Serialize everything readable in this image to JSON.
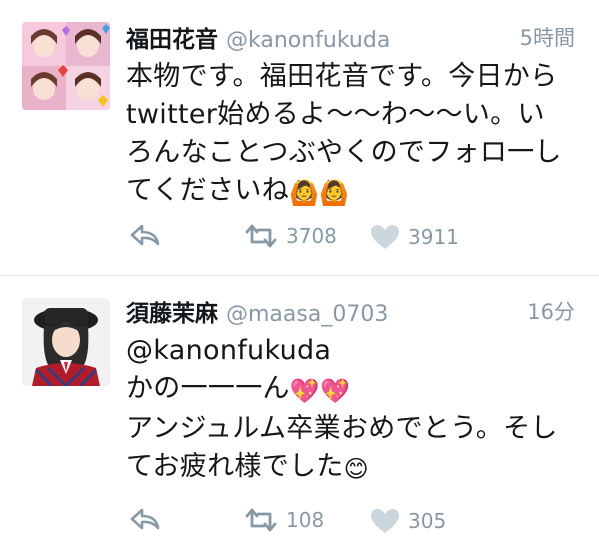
{
  "tweets": [
    {
      "name": "福田花音",
      "handle": "@kanonfukuda",
      "time": "5時間",
      "text": "本物です。福田花音です。今日から\ntwitter始めるよ〜〜わ〜〜い。い\nろんなことつぶやくのでフォロ一し\nてくださいね",
      "emojis": "🙆🙆",
      "retweets": "3708",
      "likes": "3911"
    },
    {
      "name": "須藤茉麻",
      "handle": "@maasa_0703",
      "time": "16分",
      "text_line1": "@kanonfukuda",
      "text_line2": "かの一一一ん",
      "emojis_line2": "💖💖",
      "text_rest": "アンジュルム卒業おめでとう。そし\nてお疲れ様でした",
      "emojis_rest": "😊",
      "retweets": "108",
      "likes": "305"
    }
  ],
  "colors": {
    "text": "#14171a",
    "muted": "#8899a6",
    "divider": "#e1e8ed"
  },
  "icons": {
    "reply": "reply-icon",
    "retweet": "retweet-icon",
    "like": "heart-icon"
  }
}
